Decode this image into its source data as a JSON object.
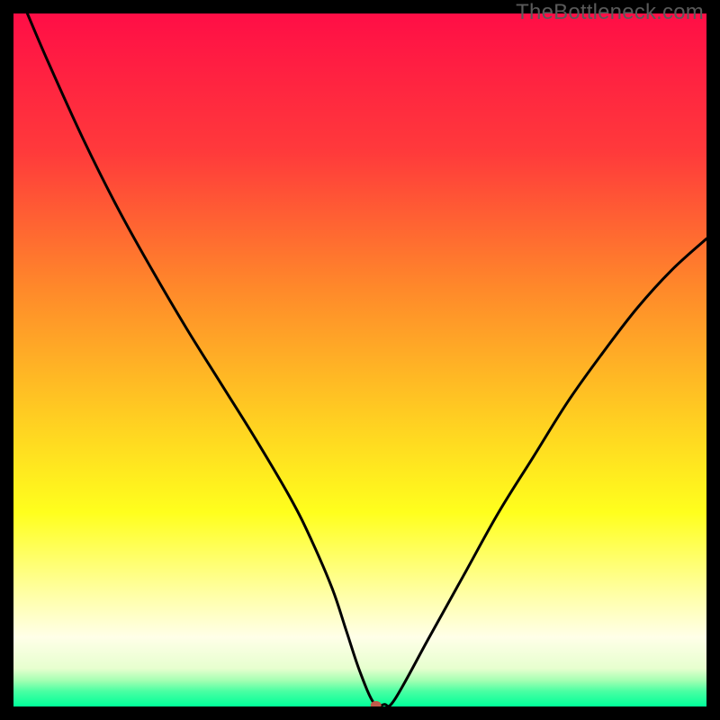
{
  "watermark": "TheBottleneck.com",
  "chart_data": {
    "type": "line",
    "title": "",
    "xlabel": "",
    "ylabel": "",
    "xlim": [
      0,
      100
    ],
    "ylim": [
      0,
      100
    ],
    "background_gradient": {
      "stops": [
        {
          "pos": 0.0,
          "color": "#ff0e46"
        },
        {
          "pos": 0.2,
          "color": "#ff3a3b"
        },
        {
          "pos": 0.4,
          "color": "#ff8a2a"
        },
        {
          "pos": 0.6,
          "color": "#ffd421"
        },
        {
          "pos": 0.72,
          "color": "#ffff1d"
        },
        {
          "pos": 0.84,
          "color": "#ffffa8"
        },
        {
          "pos": 0.9,
          "color": "#ffffe8"
        },
        {
          "pos": 0.945,
          "color": "#e7ffcf"
        },
        {
          "pos": 0.962,
          "color": "#a6ffb3"
        },
        {
          "pos": 0.978,
          "color": "#4affa3"
        },
        {
          "pos": 1.0,
          "color": "#00ff99"
        }
      ]
    },
    "series": [
      {
        "name": "bottleneck-curve",
        "x": [
          2,
          5,
          10,
          15,
          20,
          25,
          30,
          35,
          40,
          43,
          46,
          48,
          50,
          52,
          53.5,
          55,
          60,
          65,
          70,
          75,
          80,
          85,
          90,
          95,
          100
        ],
        "y": [
          100,
          93,
          82,
          72,
          63,
          54.5,
          46.5,
          38.5,
          30,
          24,
          17,
          11,
          5,
          0.5,
          0.3,
          1,
          10,
          19,
          28,
          36,
          44,
          51,
          57.5,
          63,
          67.5
        ]
      }
    ],
    "marker": {
      "name": "current-point",
      "x": 52.3,
      "y": 0.2,
      "color": "#c05a4a",
      "rx": 6,
      "ry": 4.6
    }
  }
}
